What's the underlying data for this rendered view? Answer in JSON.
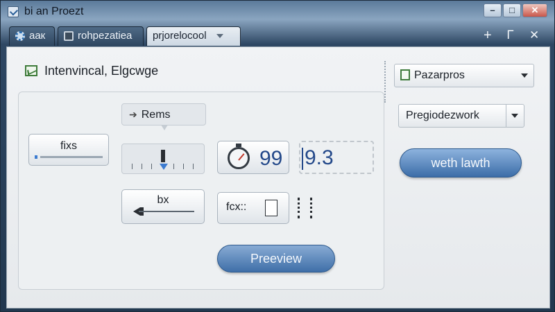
{
  "window": {
    "title": "bi an Proezt",
    "controls": {
      "minimize": "–",
      "maximize": "□",
      "close": "✕"
    }
  },
  "tabs": [
    {
      "label": "aaк",
      "icon": "gear-icon"
    },
    {
      "label": "rohpezatiea",
      "icon": "document-icon"
    },
    {
      "label": "prjorelocool",
      "icon": "chevron-down-icon"
    }
  ],
  "tabstrip_actions": {
    "add": "+",
    "split": "Ꮁ",
    "close": "✕"
  },
  "header": {
    "title": "Intenvincal, Elgcwge",
    "icon": "chart-icon"
  },
  "controls": {
    "fixs_label": "fixs",
    "callout_label": "Rems",
    "gauge_value": "99",
    "readout_value": "9.3",
    "bx_label": "bx",
    "fcx_label": "fcx::",
    "preview_label": "Preeview"
  },
  "sidebar": {
    "dropdown_primary": {
      "value": "Pazarpros",
      "icon": "sheet-icon"
    },
    "dropdown_secondary": {
      "value": "Pregiodezwork"
    },
    "action_label": "weth lawth"
  }
}
